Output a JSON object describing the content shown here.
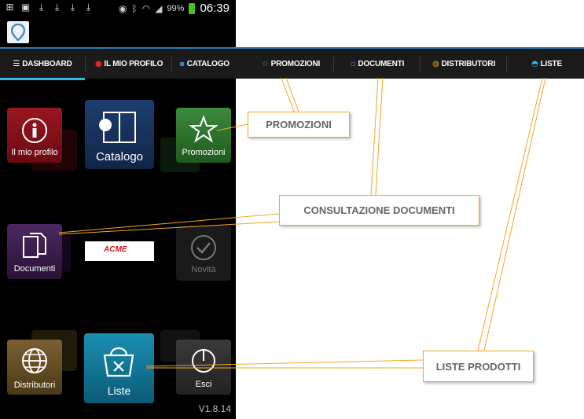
{
  "statusbar": {
    "battery_pct": "99%",
    "time": "06:39"
  },
  "tabs": [
    {
      "label": "DASHBOARD",
      "icon": "list-icon",
      "glyph": "☰",
      "color": "#ffffff"
    },
    {
      "label": "IL MIO PROFILO",
      "icon": "profile-icon",
      "glyph": "●",
      "color": "#e0262c"
    },
    {
      "label": "CATALOGO",
      "icon": "catalog-icon",
      "glyph": "▪",
      "color": "#3a7ac8"
    },
    {
      "label": "PROMOZIONI",
      "icon": "star-icon",
      "glyph": "☆",
      "color": "#4caf50"
    },
    {
      "label": "DOCUMENTI",
      "icon": "document-icon",
      "glyph": "▫",
      "color": "#9c4fc8"
    },
    {
      "label": "DISTRIBUTORI",
      "icon": "globe-icon",
      "glyph": "◍",
      "color": "#e0a020"
    },
    {
      "label": "LISTE",
      "icon": "basket-icon",
      "glyph": "◓",
      "color": "#33b5e5"
    }
  ],
  "tiles": {
    "profilo": "Il mio profilo",
    "catalogo": "Catalogo",
    "promozioni": "Promozioni",
    "documenti": "Documenti",
    "acme": "ACME",
    "novita": "Novità",
    "distributori": "Distributori",
    "liste": "Liste",
    "esci": "Esci"
  },
  "version": "V1.8.14",
  "callouts": {
    "promozioni": "PROMOZIONI",
    "documenti": "CONSULTAZIONE DOCUMENTI",
    "liste": "LISTE PRODOTTI"
  },
  "colors": {
    "accent": "#33b5e5",
    "callout_border": "#f5a623"
  }
}
